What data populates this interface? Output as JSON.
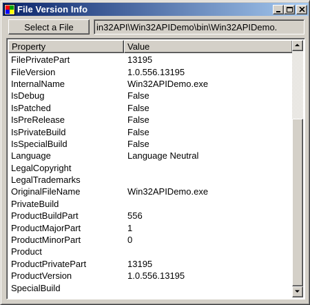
{
  "window": {
    "title": "File Version Info",
    "icon": "app-icon"
  },
  "caption_buttons": {
    "minimize": "minimize-icon",
    "maximize": "maximize-icon",
    "close": "close-icon"
  },
  "toolbar": {
    "select_label": "Select a File",
    "path_value": "in32API\\Win32APIDemo\\bin\\Win32APIDemo."
  },
  "grid": {
    "columns": [
      "Property",
      "Value"
    ],
    "rows": [
      [
        "FilePrivatePart",
        "13195"
      ],
      [
        "FileVersion",
        "1.0.556.13195"
      ],
      [
        "InternalName",
        "Win32APIDemo.exe"
      ],
      [
        "IsDebug",
        "False"
      ],
      [
        "IsPatched",
        "False"
      ],
      [
        "IsPreRelease",
        "False"
      ],
      [
        "IsPrivateBuild",
        "False"
      ],
      [
        "IsSpecialBuild",
        "False"
      ],
      [
        "Language",
        "Language Neutral"
      ],
      [
        "LegalCopyright",
        ""
      ],
      [
        "LegalTrademarks",
        ""
      ],
      [
        "OriginalFileName",
        "Win32APIDemo.exe"
      ],
      [
        "PrivateBuild",
        ""
      ],
      [
        "ProductBuildPart",
        "556"
      ],
      [
        "ProductMajorPart",
        "1"
      ],
      [
        "ProductMinorPart",
        "0"
      ],
      [
        "Product",
        ""
      ],
      [
        "ProductPrivatePart",
        "13195"
      ],
      [
        "ProductVersion",
        "1.0.556.13195"
      ],
      [
        "SpecialBuild",
        ""
      ]
    ]
  },
  "colors": {
    "titlebar_start": "#0a246a",
    "titlebar_end": "#a6caf0",
    "face": "#d4d0c8"
  }
}
